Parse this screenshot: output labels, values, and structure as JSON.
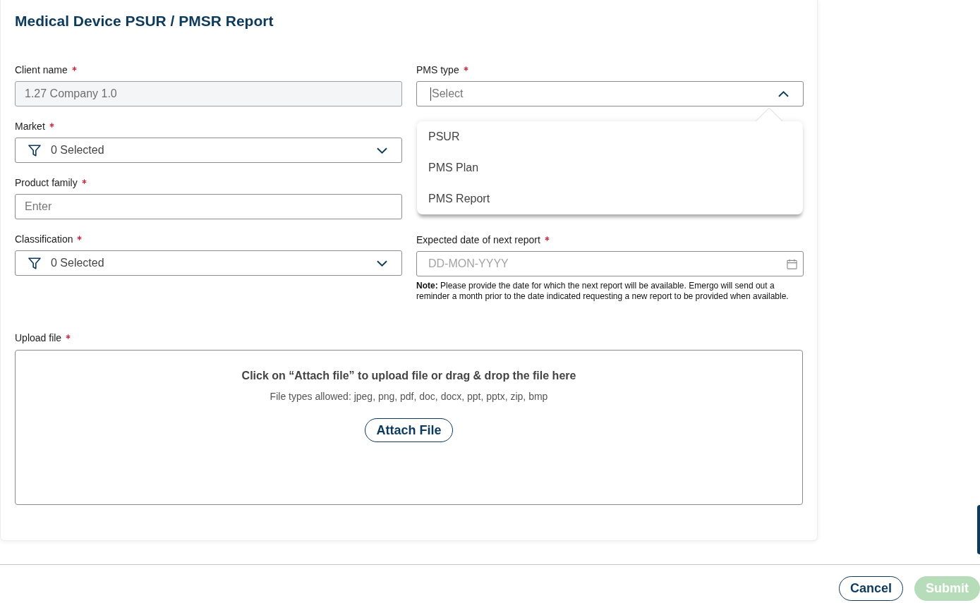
{
  "page_title": "Medical Device PSUR / PMSR Report",
  "form": {
    "left_column": [
      {
        "kind": "text",
        "label": "Client name",
        "required": true,
        "value": "1.27 Company 1.0",
        "disabled": true
      },
      {
        "kind": "multiselect",
        "label": "Market",
        "required": true,
        "value": "0 Selected"
      },
      {
        "kind": "text",
        "label": "Product family",
        "required": true,
        "placeholder": "Enter",
        "disabled": false
      },
      {
        "kind": "multiselect",
        "label": "Classification",
        "required": true,
        "value": "0 Selected"
      }
    ],
    "right_column": [
      {
        "kind": "select",
        "label": "PMS type",
        "required": true,
        "placeholder": "Select",
        "focused": true,
        "expanded": true,
        "options": [
          {
            "label": "PSUR",
            "selected": false
          },
          {
            "label": "PMS Plan",
            "selected": false
          },
          {
            "label": "PMS Report",
            "selected": false
          }
        ]
      },
      {
        "kind": "date",
        "label": "Expected date of next report",
        "required": true,
        "placeholder": "DD-MON-YYYY",
        "note": "**Note:** Please provide the date for which the next report will be available. Emergo will send out a reminder a month prior to the date indicated requesting a new report to be provided when available."
      }
    ]
  },
  "upload": {
    "label": "Upload file",
    "required": true,
    "instruction": "Click on “Attach file” to upload file or drag & drop the file here",
    "allowed_types": "File types allowed: jpeg, png, pdf, doc, docx, ppt, pptx, zip, bmp",
    "button": "Attach File"
  },
  "actions": [
    {
      "label": "Cancel",
      "kind": "secondary",
      "disabled": false
    },
    {
      "label": "Submit",
      "kind": "primary",
      "disabled": true
    }
  ]
}
